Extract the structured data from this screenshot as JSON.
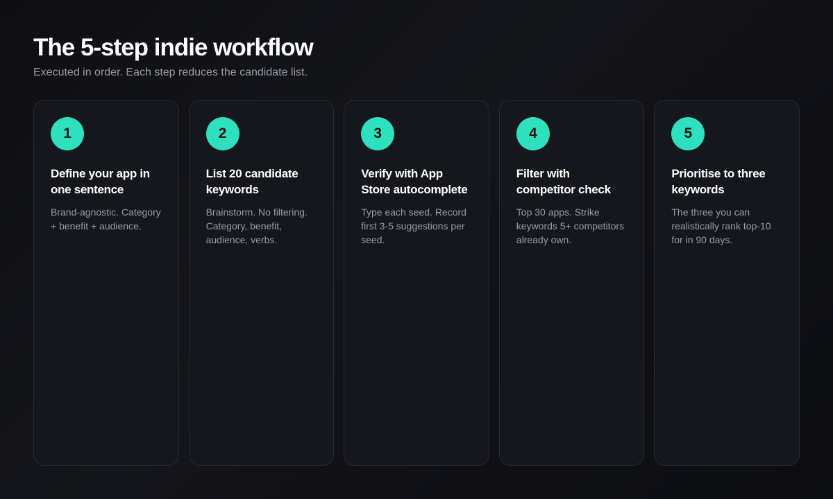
{
  "header": {
    "title": "The 5-step indie workflow",
    "subtitle": "Executed in order. Each step reduces the candidate list."
  },
  "steps": [
    {
      "number": "1",
      "title": "Define your app in one sentence",
      "description": "Brand-agnostic. Category + benefit + audience."
    },
    {
      "number": "2",
      "title": "List 20 candidate keywords",
      "description": "Brainstorm. No filtering. Category, benefit, audience, verbs."
    },
    {
      "number": "3",
      "title": "Verify with App Store autocomplete",
      "description": "Type each seed. Record first 3-5 suggestions per seed."
    },
    {
      "number": "4",
      "title": "Filter with competitor check",
      "description": "Top 30 apps. Strike keywords 5+ competitors already own."
    },
    {
      "number": "5",
      "title": "Prioritise to three keywords",
      "description": "The three you can realistically rank top-10 for in 90 days."
    }
  ],
  "colors": {
    "accent": "#2fe0bf",
    "background": "#121217",
    "card": "#16171c",
    "muted_text": "#9a9ca3"
  }
}
